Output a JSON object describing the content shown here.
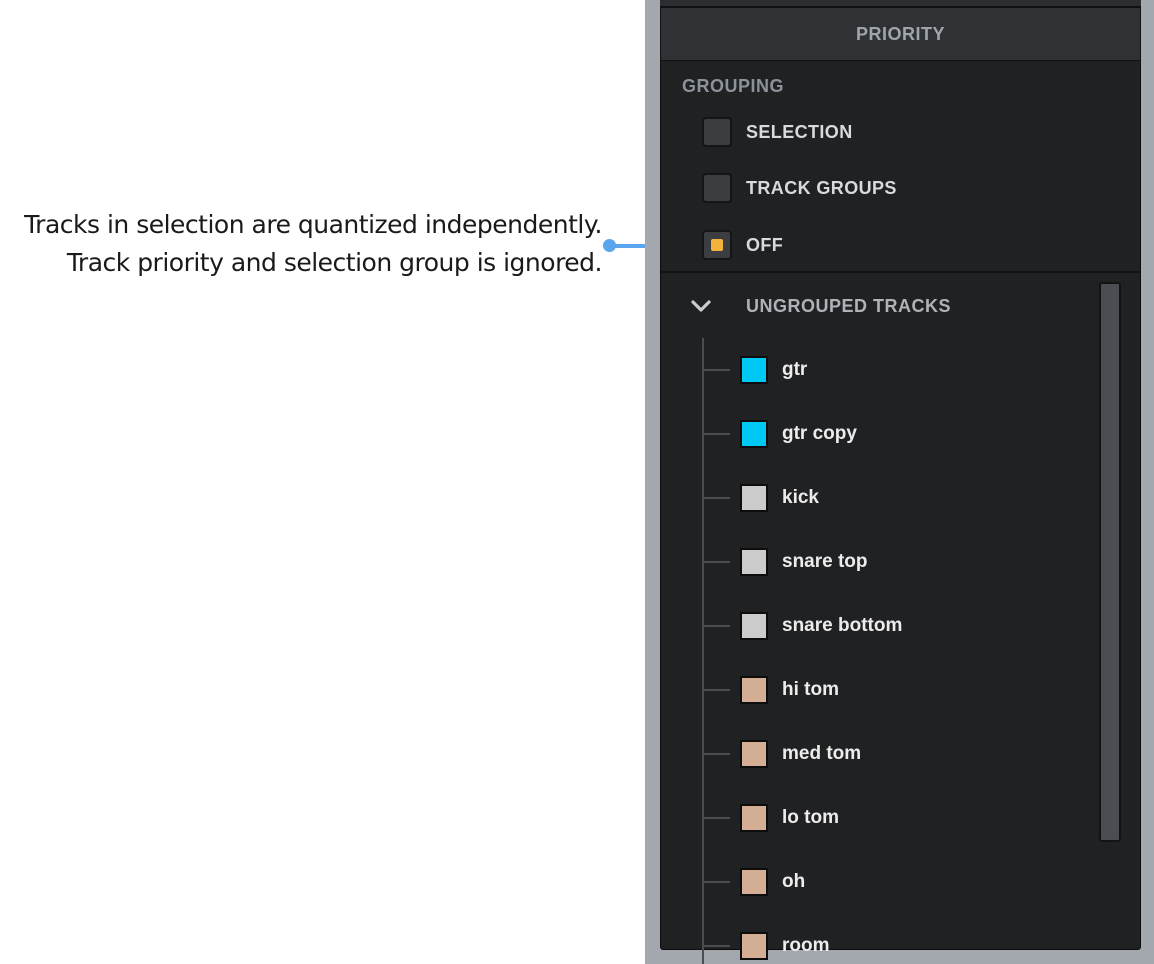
{
  "annotation": {
    "line1": "Tracks in selection are quantized independently.",
    "line2": "Track priority and selection group is ignored.",
    "accent_color": "#5aa6ee"
  },
  "panel": {
    "header": "PRIORITY",
    "grouping_label": "GROUPING",
    "options": [
      {
        "label": "SELECTION",
        "checked": false
      },
      {
        "label": "TRACK GROUPS",
        "checked": false
      },
      {
        "label": "OFF",
        "checked": true
      }
    ],
    "checked_color": "#f1b33a",
    "group": {
      "label": "UNGROUPED TRACKS",
      "expanded": true,
      "icon": "chevron-down-icon"
    },
    "tracks": [
      {
        "name": "gtr",
        "color": "#00c8f4"
      },
      {
        "name": "gtr copy",
        "color": "#00c8f4"
      },
      {
        "name": "kick",
        "color": "#cbcbcb"
      },
      {
        "name": "snare top",
        "color": "#cbcbcb"
      },
      {
        "name": "snare bottom",
        "color": "#cbcbcb"
      },
      {
        "name": "hi tom",
        "color": "#d4ae94"
      },
      {
        "name": "med tom",
        "color": "#d4ae94"
      },
      {
        "name": "lo tom",
        "color": "#d4ae94"
      },
      {
        "name": "oh",
        "color": "#d4ae94"
      },
      {
        "name": "room",
        "color": "#d4ae94"
      }
    ]
  }
}
